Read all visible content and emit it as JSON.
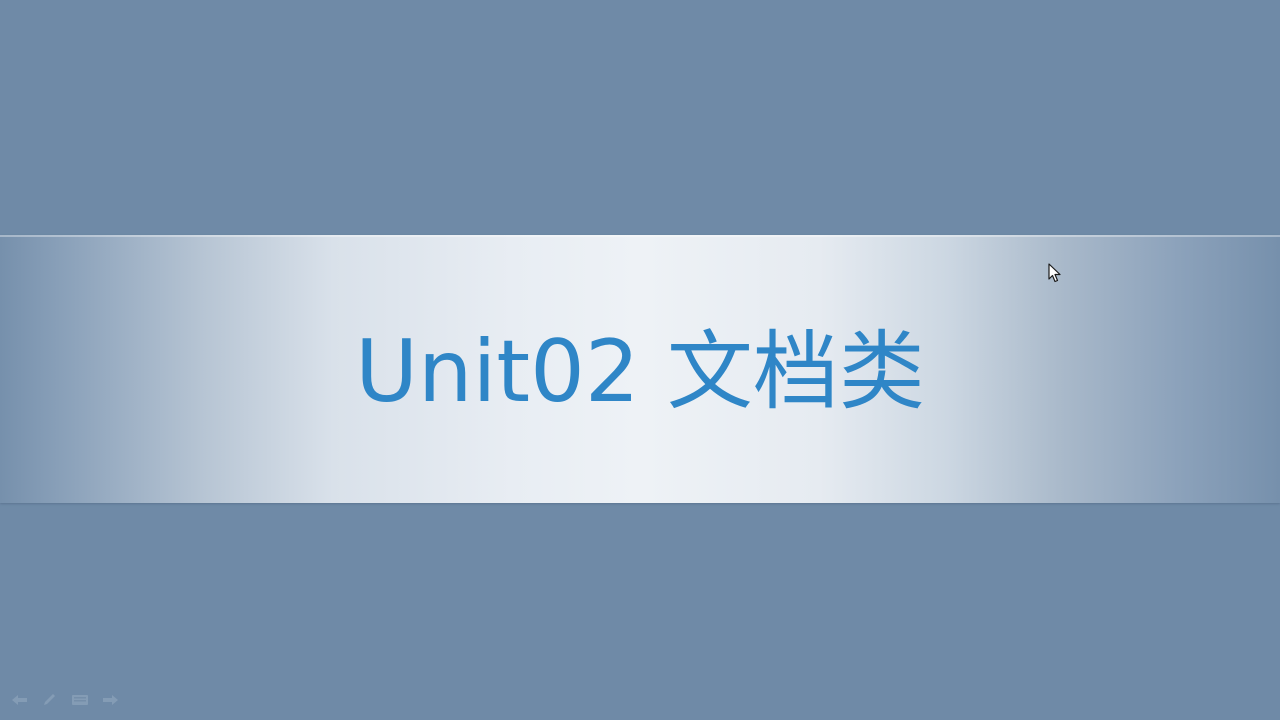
{
  "slide": {
    "title": "Unit02 文档类",
    "title_color": "#2f86c7",
    "background_color": "#6f8aa7"
  },
  "presenter_toolbar": {
    "buttons": [
      {
        "name": "previous-slide-icon"
      },
      {
        "name": "pen-icon"
      },
      {
        "name": "slide-menu-icon"
      },
      {
        "name": "next-slide-icon"
      }
    ]
  },
  "cursor": {
    "icon": "mouse-pointer-icon"
  }
}
